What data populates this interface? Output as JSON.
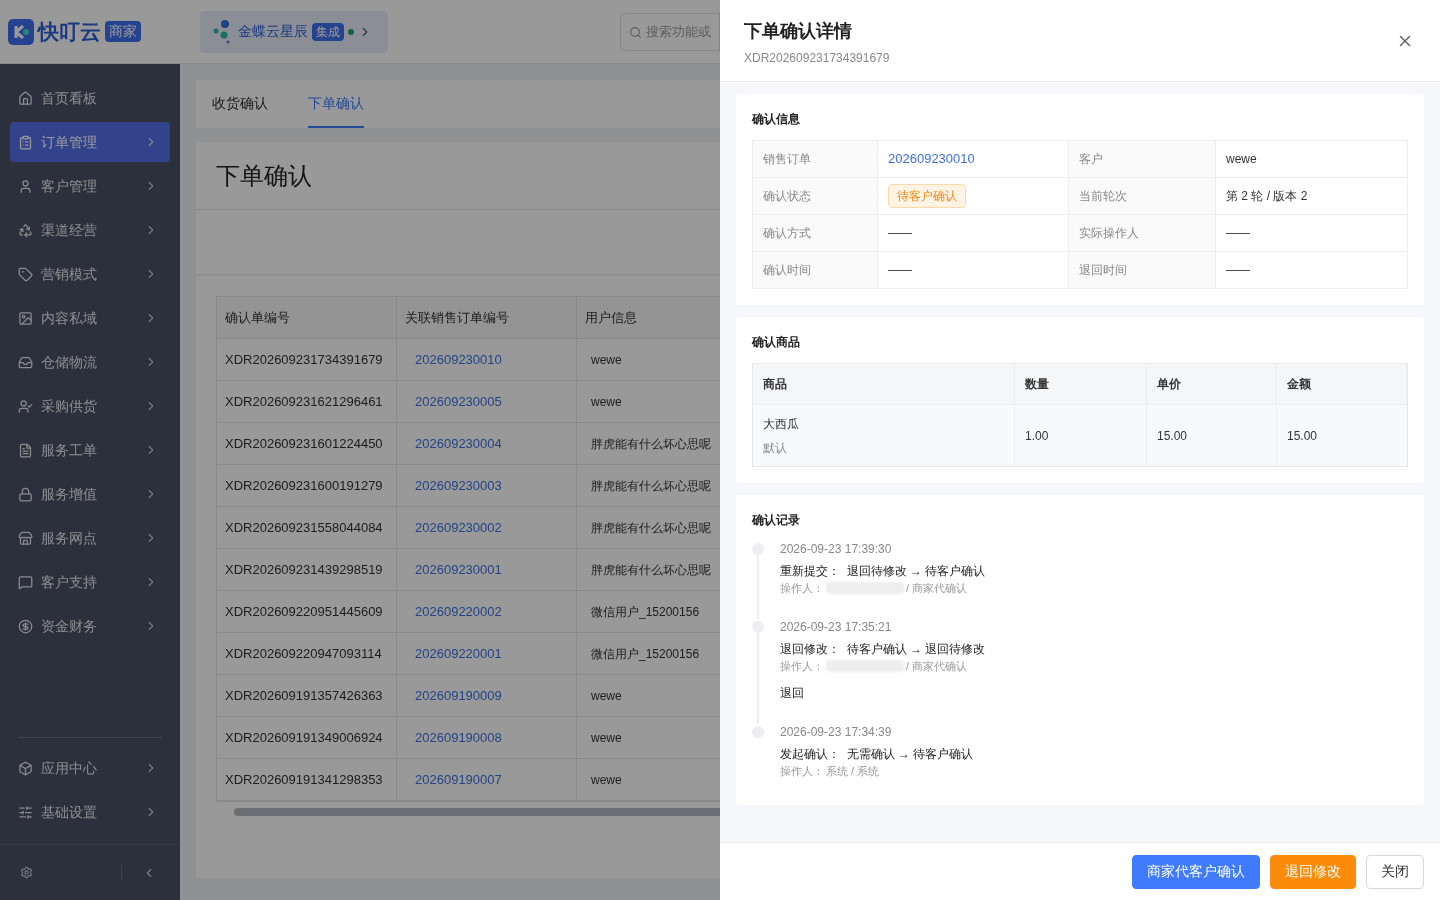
{
  "header": {
    "logo_text": "快叮云",
    "logo_badge": "商家",
    "app": {
      "name": "金蝶云星辰",
      "badge": "集成"
    },
    "search": {
      "placeholder": "搜索功能或"
    }
  },
  "sidebar": {
    "items": [
      {
        "label": "首页看板",
        "selected": false,
        "has_children": false
      },
      {
        "label": "订单管理",
        "selected": true,
        "has_children": true
      },
      {
        "label": "客户管理",
        "selected": false,
        "has_children": true
      },
      {
        "label": "渠道经营",
        "selected": false,
        "has_children": true
      },
      {
        "label": "营销模式",
        "selected": false,
        "has_children": true
      },
      {
        "label": "内容私域",
        "selected": false,
        "has_children": true
      },
      {
        "label": "仓储物流",
        "selected": false,
        "has_children": true
      },
      {
        "label": "采购供货",
        "selected": false,
        "has_children": true
      },
      {
        "label": "服务工单",
        "selected": false,
        "has_children": true
      },
      {
        "label": "服务增值",
        "selected": false,
        "has_children": true
      },
      {
        "label": "服务网点",
        "selected": false,
        "has_children": true
      },
      {
        "label": "客户支持",
        "selected": false,
        "has_children": true
      },
      {
        "label": "资金财务",
        "selected": false,
        "has_children": true
      }
    ],
    "bottom_items": [
      {
        "label": "应用中心",
        "selected": false,
        "has_children": true
      },
      {
        "label": "基础设置",
        "selected": false,
        "has_children": true
      }
    ]
  },
  "page": {
    "tabs": [
      {
        "label": "收货确认",
        "selected": false
      },
      {
        "label": "下单确认",
        "selected": true
      }
    ],
    "title": "下单确认",
    "table": {
      "columns": [
        "确认单编号",
        "关联销售订单编号",
        "用户信息"
      ],
      "rows": [
        [
          "XDR202609231734391679",
          "202609230010",
          "wewe"
        ],
        [
          "XDR202609231621296461",
          "202609230005",
          "wewe"
        ],
        [
          "XDR202609231601224450",
          "202609230004",
          "胖虎能有什么坏心思呢"
        ],
        [
          "XDR202609231600191279",
          "202609230003",
          "胖虎能有什么坏心思呢"
        ],
        [
          "XDR202609231558044084",
          "202609230002",
          "胖虎能有什么坏心思呢"
        ],
        [
          "XDR202609231439298519",
          "202609230001",
          "胖虎能有什么坏心思呢"
        ],
        [
          "XDR202609220951445609",
          "202609220002",
          "微信用户_15200156"
        ],
        [
          "XDR202609220947093114",
          "202609220001",
          "微信用户_15200156"
        ],
        [
          "XDR202609191357426363",
          "202609190009",
          "wewe"
        ],
        [
          "XDR202609191349006924",
          "202609190008",
          "wewe"
        ],
        [
          "XDR202609191341298353",
          "202609190007",
          "wewe"
        ]
      ]
    }
  },
  "drawer": {
    "title": "下单确认详情",
    "subtitle": "XDR202609231734391679",
    "info": {
      "title": "确认信息",
      "fields": [
        {
          "label": "销售订单",
          "value": "202609230010",
          "kind": "link"
        },
        {
          "label": "客户",
          "value": "wewe",
          "kind": "text"
        },
        {
          "label": "确认状态",
          "value": "待客户确认",
          "kind": "tag"
        },
        {
          "label": "当前轮次",
          "value": "第 2 轮 / 版本 2",
          "kind": "text"
        },
        {
          "label": "确认方式",
          "value": "——",
          "kind": "text"
        },
        {
          "label": "实际操作人",
          "value": "——",
          "kind": "text"
        },
        {
          "label": "确认时间",
          "value": "——",
          "kind": "text"
        },
        {
          "label": "退回时间",
          "value": "——",
          "kind": "text"
        }
      ]
    },
    "goods": {
      "title": "确认商品",
      "columns": [
        "商品",
        "数量",
        "单价",
        "金额"
      ],
      "rows": [
        {
          "name": "大西瓜",
          "spec": "默认",
          "qty": "1.00",
          "price": "15.00",
          "amount": "15.00"
        }
      ]
    },
    "records": {
      "title": "确认记录",
      "items": [
        {
          "time": "2026-09-23 17:39:30",
          "action": "重新提交：  退回待修改 → 待客户确认",
          "operator_label": "操作人：",
          "redacted": true,
          "operator": "/ 商家代确认"
        },
        {
          "time": "2026-09-23 17:35:21",
          "action": "退回修改：  待客户确认 → 退回待修改",
          "operator_label": "操作人：",
          "redacted": true,
          "operator": "/ 商家代确认",
          "note": "退回"
        },
        {
          "time": "2026-09-23 17:34:39",
          "action": "发起确认：  无需确认 → 待客户确认",
          "operator_label": "操作人：",
          "redacted": false,
          "operator": "系统 / 系统"
        }
      ]
    },
    "buttons": [
      {
        "label": "商家代客户确认",
        "kind": "primary"
      },
      {
        "label": "退回修改",
        "kind": "warning"
      },
      {
        "label": "关闭",
        "kind": "default"
      }
    ]
  }
}
